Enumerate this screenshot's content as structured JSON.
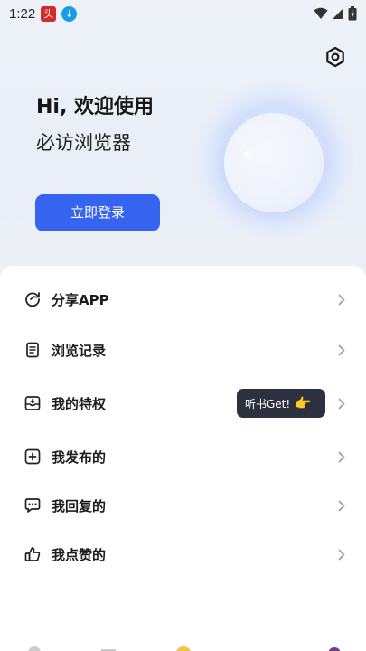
{
  "status_bar": {
    "time": "1:22",
    "app_badge_text": "头",
    "download_badge_text": "↓"
  },
  "header": {
    "greeting": "Hi, 欢迎使用",
    "app_name": "必访浏览器",
    "login_label": "立即登录"
  },
  "menu": {
    "items": [
      {
        "label": "分享APP",
        "icon": "share-icon"
      },
      {
        "label": "浏览记录",
        "icon": "history-icon"
      },
      {
        "label": "我的特权",
        "icon": "privilege-icon"
      },
      {
        "label": "我发布的",
        "icon": "publish-icon"
      },
      {
        "label": "我回复的",
        "icon": "reply-icon"
      },
      {
        "label": "我点赞的",
        "icon": "like-icon"
      }
    ]
  },
  "tooltip": {
    "text": "听书Get!"
  },
  "colors": {
    "accent": "#3663f0",
    "tooltip_bg": "#2c3140",
    "page_bg": "#eef1f6"
  }
}
